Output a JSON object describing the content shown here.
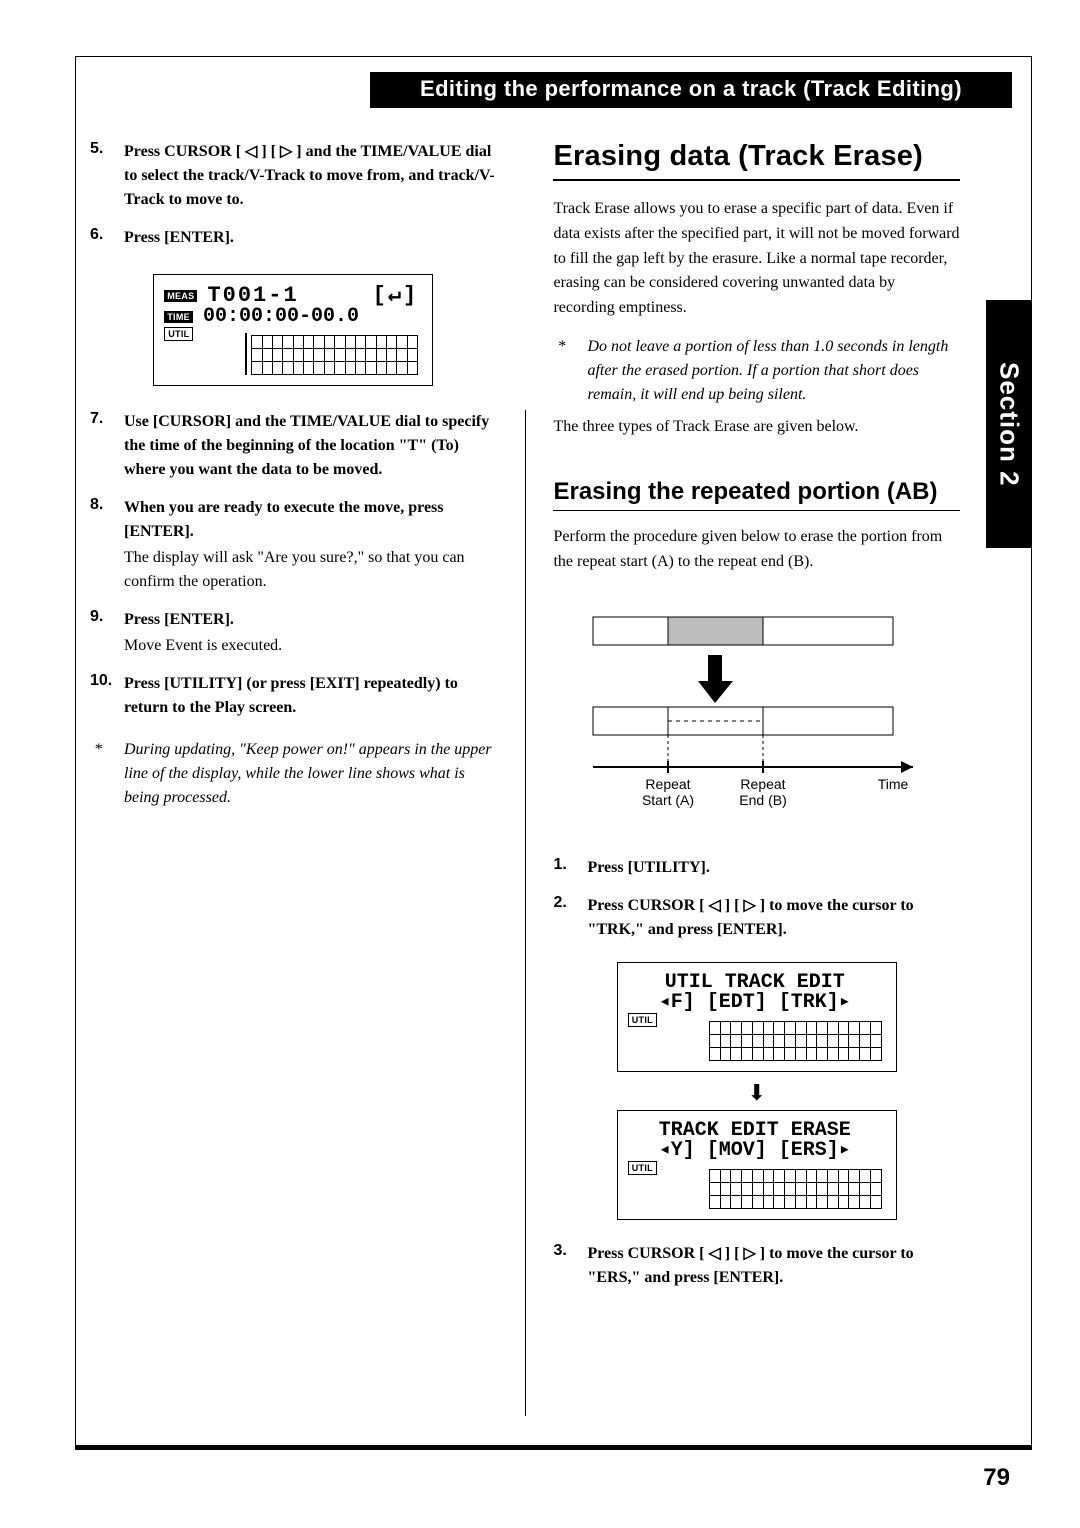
{
  "header": "Editing the performance on a track (Track Editing)",
  "side_tab": "Section 2",
  "page_number": "79",
  "left": {
    "steps": [
      {
        "n": "5.",
        "main": "Press CURSOR [ ◁ ] [ ▷ ] and the TIME/VALUE dial to select the track/V-Track to move from, and track/V-Track to move to."
      },
      {
        "n": "6.",
        "main": "Press [ENTER]."
      },
      {
        "n": "7.",
        "main": "Use [CURSOR] and the TIME/VALUE dial to specify the time of the beginning of the location \"T\" (To) where you want the data to be moved."
      },
      {
        "n": "8.",
        "main": "When you are ready to execute the move, press [ENTER].",
        "sub": "The display will ask \"Are you sure?,\" so that you can confirm the operation."
      },
      {
        "n": "9.",
        "main": "Press [ENTER].",
        "sub": "Move Event is executed."
      },
      {
        "n": "10.",
        "main": "Press [UTILITY] (or press [EXIT] repeatedly) to return to the Play screen."
      }
    ],
    "note": "During updating, \"Keep power on!\" appears in the upper line of the display, while the lower line shows what is being processed.",
    "lcd": {
      "labels": {
        "meas": "MEAS",
        "time": "TIME",
        "util": "UTIL"
      },
      "line1": "T001-1",
      "line1_right": "[↵]",
      "line2": "00:00:00-00.0"
    }
  },
  "right": {
    "h1": "Erasing data (Track Erase)",
    "intro": "Track Erase allows you to erase a specific part of data. Even if data exists after the specified part, it will not be moved forward to fill the gap left by the erasure. Like a normal tape recorder, erasing can be considered covering unwanted data by recording emptiness.",
    "note": "Do not leave a portion of less than 1.0 seconds in length after the erased portion. If a portion that short does remain, it will end up being silent.",
    "after_note": "The three types of Track Erase are given below.",
    "h2": "Erasing the repeated portion (AB)",
    "h2_intro": "Perform the procedure given below to erase the portion from the repeat start (A) to the repeat end (B).",
    "diagram_labels": {
      "a": "Repeat\nStart (A)",
      "b": "Repeat\nEnd (B)",
      "t": "Time"
    },
    "steps": [
      {
        "n": "1.",
        "main": "Press [UTILITY]."
      },
      {
        "n": "2.",
        "main": "Press CURSOR [ ◁ ] [ ▷ ] to move the cursor to \"TRK,\" and press [ENTER]."
      },
      {
        "n": "3.",
        "main": "Press CURSOR [ ◁ ] [ ▷ ] to move the cursor to \"ERS,\" and press [ENTER]."
      }
    ],
    "lcd1": {
      "util": "UTIL",
      "line1": "UTIL  TRACK EDIT",
      "line2": "◂F] [EDT] [TRK]▸"
    },
    "lcd2": {
      "util": "UTIL",
      "line1": "TRACK EDIT ERASE",
      "line2": "◂Y] [MOV] [ERS]▸"
    }
  }
}
